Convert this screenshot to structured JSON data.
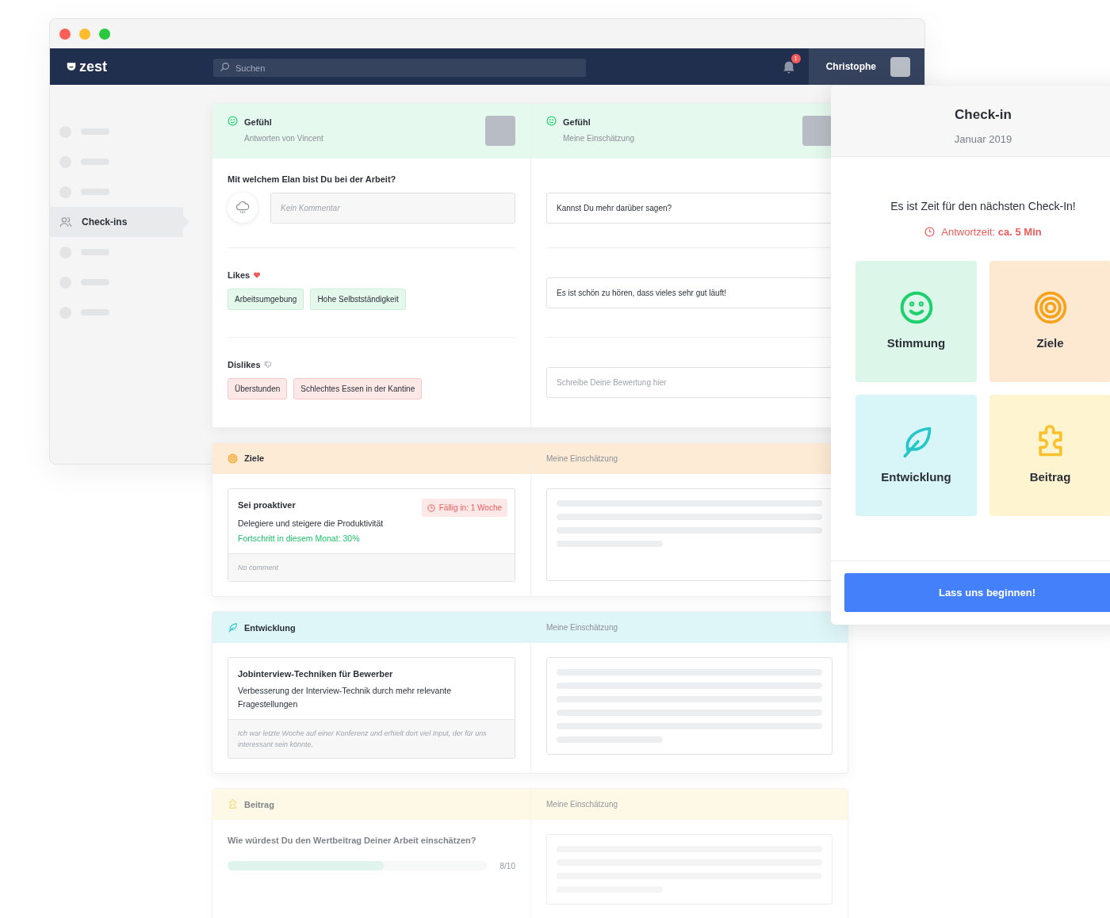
{
  "navbar": {
    "logo": "zest",
    "search": {
      "placeholder": "Suchen"
    },
    "notification_count": "1",
    "user": "Christophe"
  },
  "sidebar": {
    "items": [
      {
        "kind": "placeholder",
        "selected": false
      },
      {
        "kind": "placeholder",
        "selected": false
      },
      {
        "kind": "placeholder",
        "selected": false
      },
      {
        "kind": "item",
        "label": "Check-ins",
        "selected": true
      },
      {
        "kind": "placeholder",
        "selected": false
      },
      {
        "kind": "placeholder",
        "selected": false
      },
      {
        "kind": "placeholder",
        "selected": false
      }
    ]
  },
  "sections": [
    {
      "kind": "mood",
      "faded": false,
      "left_header": {
        "title": "Gefühl",
        "subtitle": "Antworten von Vincent"
      },
      "right_header": {
        "title": "Gefühl",
        "subtitle": "Meine Einschätzung"
      },
      "question": "Mit welchem Elan bist Du bei der Arbeit?",
      "comment": {
        "placeholder": "Kein Kommentar"
      },
      "likes": {
        "label": "Likes",
        "tags": [
          "Arbeitsumgebung",
          "Hohe Selbstständigkeit"
        ]
      },
      "dislikes": {
        "label": "Dislikes",
        "tags": [
          "Überstunden",
          "Schlechtes Essen in der Kantine"
        ]
      },
      "answers": [
        {
          "value": "Kannst Du mehr darüber sagen?"
        },
        {
          "value": "Es ist schön zu hören, dass vieles sehr gut läuft!"
        },
        {
          "placeholder": "Schreibe Deine Bewertung hier"
        }
      ]
    },
    {
      "kind": "goals",
      "faded": false,
      "left_header": {
        "title": "Ziele"
      },
      "right_header": {
        "subtitle": "Meine Einschätzung"
      },
      "item": {
        "title": "Sei proaktiver",
        "description": "Delegiere und steigere die Produktivität",
        "progress": "Fortschritt in diesem Monat: 30%",
        "due": "Fällig in: 1 Woche",
        "comment": "No comment"
      }
    },
    {
      "kind": "development",
      "faded": false,
      "left_header": {
        "title": "Entwicklung"
      },
      "right_header": {
        "subtitle": "Meine Einschätzung"
      },
      "item": {
        "title": "Jobinterview-Techniken für Bewerber",
        "description": "Verbesserung der Interview-Technik durch mehr relevante Fragestellungen",
        "comment": "Ich war letzte Woche auf einer Konferenz und erhielt dort viel Input, der für uns interessant sein könnte."
      }
    },
    {
      "kind": "contribution",
      "faded": true,
      "left_header": {
        "title": "Beitrag"
      },
      "right_header": {
        "subtitle": "Meine Einschätzung"
      },
      "question": "Wie würdest Du den Wertbeitrag Deiner Arbeit einschätzen?",
      "rating": {
        "level": 0.6,
        "reading": "8/10"
      }
    }
  ],
  "panel": {
    "title": "Check-in",
    "subtitle": "Januar 2019",
    "message": "Es ist Zeit für den nächsten Check-In!",
    "time": "Antwortzeit: **ca. 5 Min**",
    "tiles": [
      {
        "kind": "mood",
        "label": "Stimmung",
        "color": "#dcf7ea"
      },
      {
        "kind": "goals",
        "label": "Ziele",
        "color": "#fde8d2"
      },
      {
        "kind": "development",
        "label": "Entwicklung",
        "color": "#d8f5f8"
      },
      {
        "kind": "contribution",
        "label": "Beitrag",
        "color": "#fef4cf"
      }
    ],
    "button": "Lass uns beginnen!"
  }
}
